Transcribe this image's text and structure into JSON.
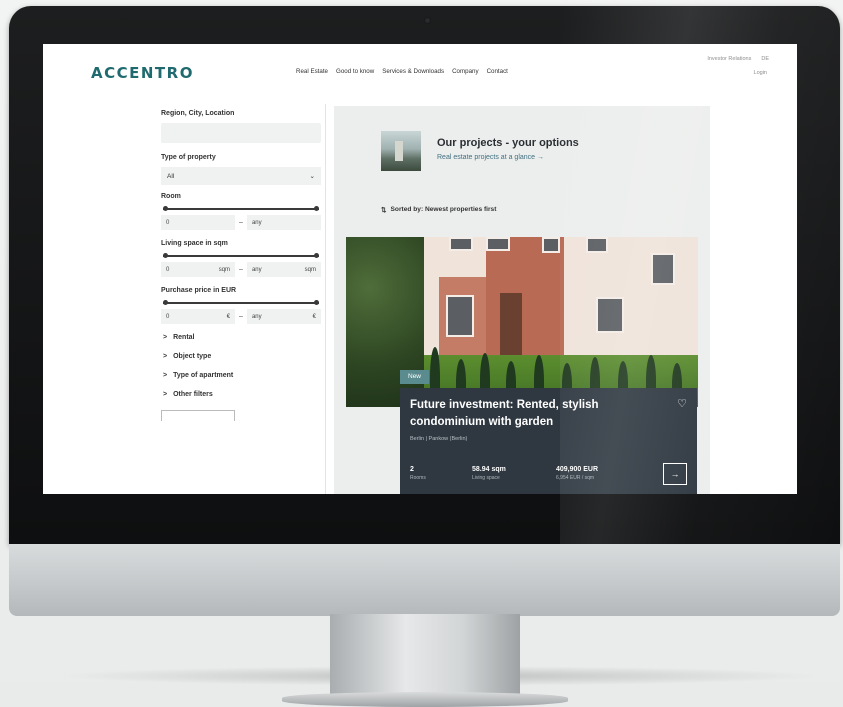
{
  "brand": {
    "logo": "ACCENTRO"
  },
  "nav": {
    "items": [
      "Real Estate",
      "Good to know",
      "Services & Downloads",
      "Company",
      "Contact"
    ]
  },
  "top_right": {
    "investor": "Investor Relations",
    "lang": "DE",
    "login": "Login"
  },
  "filters": {
    "region_label": "Region, City, Location",
    "type_label": "Type of property",
    "type_value": "All",
    "rooms_label": "Room",
    "rooms_min": "0",
    "rooms_max": "any",
    "living_label": "Living space in sqm",
    "living_min": "0",
    "living_min_unit": "sqm",
    "living_max": "any",
    "living_max_unit": "sqm",
    "price_label": "Purchase price in EUR",
    "price_min": "0",
    "price_min_unit": "€",
    "price_max": "any",
    "price_max_unit": "€",
    "collapsibles": [
      "Rental",
      "Object type",
      "Type of apartment",
      "Other filters"
    ]
  },
  "projects": {
    "title": "Our projects - your options",
    "link": "Real estate projects at a glance",
    "sort_text": "Sorted by: Newest properties first"
  },
  "card": {
    "badge": "New",
    "title": "Future investment: Rented, stylish condominium with garden",
    "location": "Berlin | Pankow (Berlin)",
    "rooms": "2",
    "rooms_label": "Rooms",
    "area": "58.94 sqm",
    "area_label": "Living space",
    "price": "409,900 EUR",
    "price_label": "6,954 EUR / sqm"
  },
  "icons": {
    "chevron": "chevron-down-icon",
    "sort": "sort-icon",
    "heart": "heart-icon",
    "arrow": "arrow-right-icon"
  },
  "colors": {
    "brand": "#1f6a6e",
    "card_bg": "#2f3841",
    "badge": "#5a8c8f"
  }
}
